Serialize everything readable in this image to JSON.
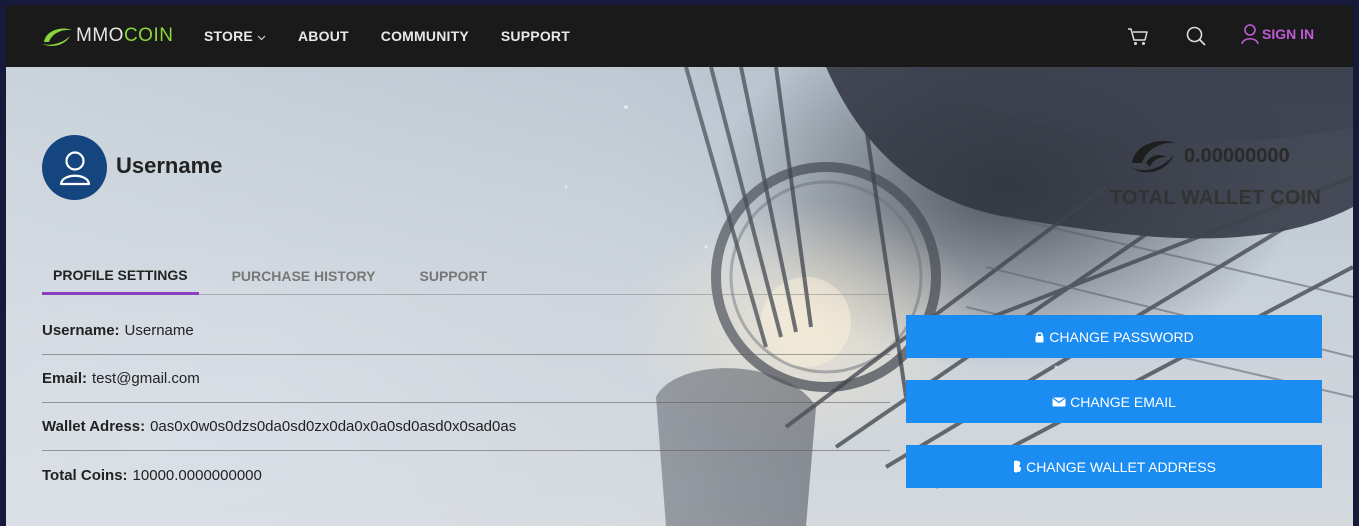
{
  "brand": {
    "logo_part1": "MMO",
    "logo_part2": "COIN",
    "accent": "#8bd63a"
  },
  "nav": {
    "items": [
      {
        "label": "STORE",
        "has_dropdown": true
      },
      {
        "label": "ABOUT"
      },
      {
        "label": "COMMUNITY"
      },
      {
        "label": "SUPPORT"
      }
    ],
    "sign_in": "SIGN IN",
    "sign_in_color": "#c05bd6",
    "icons": [
      "cart-icon",
      "search-icon",
      "user-icon"
    ]
  },
  "profile": {
    "username": "Username",
    "avatar_color": "#15457e"
  },
  "wallet": {
    "amount": "0.00000000",
    "label": "TOTAL WALLET COIN"
  },
  "tabs": [
    {
      "label": "PROFILE SETTINGS",
      "active": true
    },
    {
      "label": "PURCHASE HISTORY"
    },
    {
      "label": "SUPPORT"
    }
  ],
  "tab_accent": "#8a3fbf",
  "info": [
    {
      "label": "Username:",
      "value": "Username"
    },
    {
      "label": "Email:",
      "value": "test@gmail.com"
    },
    {
      "label": "Wallet Adress:",
      "value": "0as0x0w0s0dzs0da0sd0zx0da0x0a0sd0asd0x0sad0as"
    },
    {
      "label": "Total Coins:",
      "value": "10000.0000000000"
    }
  ],
  "actions": [
    {
      "label": "CHANGE PASSWORD",
      "icon": "lock-icon"
    },
    {
      "label": "CHANGE EMAIL",
      "icon": "envelope-icon"
    },
    {
      "label": "CHANGE WALLET ADDRESS",
      "icon": "bitcoin-icon"
    }
  ],
  "button_color": "#1a8cf2"
}
